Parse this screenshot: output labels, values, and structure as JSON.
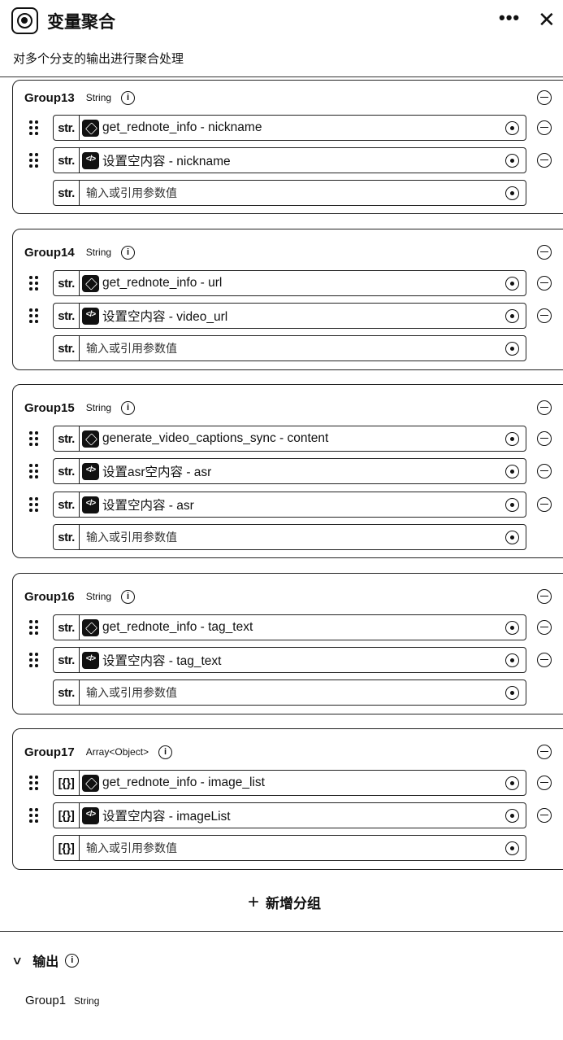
{
  "header": {
    "title": "变量聚合",
    "subtitle": "对多个分支的输出进行聚合处理",
    "icon": "variable-merge-icon"
  },
  "groups": [
    {
      "name": "Group13",
      "type": "String",
      "rows": [
        {
          "type_tag": "str.",
          "icon": "plugin",
          "text": "get_rednote_info - nickname"
        },
        {
          "type_tag": "str.",
          "icon": "code",
          "text": "设置空内容 - nickname"
        }
      ],
      "empty_type_tag": "str.",
      "placeholder": "输入或引用参数值"
    },
    {
      "name": "Group14",
      "type": "String",
      "rows": [
        {
          "type_tag": "str.",
          "icon": "plugin",
          "text": "get_rednote_info - url"
        },
        {
          "type_tag": "str.",
          "icon": "code",
          "text": "设置空内容 - video_url"
        }
      ],
      "empty_type_tag": "str.",
      "placeholder": "输入或引用参数值"
    },
    {
      "name": "Group15",
      "type": "String",
      "rows": [
        {
          "type_tag": "str.",
          "icon": "plugin",
          "text": "generate_video_captions_sync - content"
        },
        {
          "type_tag": "str.",
          "icon": "code",
          "text": "设置asr空内容 - asr"
        },
        {
          "type_tag": "str.",
          "icon": "code",
          "text": "设置空内容 - asr"
        }
      ],
      "empty_type_tag": "str.",
      "placeholder": "输入或引用参数值"
    },
    {
      "name": "Group16",
      "type": "String",
      "rows": [
        {
          "type_tag": "str.",
          "icon": "plugin",
          "text": "get_rednote_info - tag_text"
        },
        {
          "type_tag": "str.",
          "icon": "code",
          "text": "设置空内容 - tag_text"
        }
      ],
      "empty_type_tag": "str.",
      "placeholder": "输入或引用参数值"
    },
    {
      "name": "Group17",
      "type": "Array<Object>",
      "rows": [
        {
          "type_tag": "[{}]",
          "icon": "plugin",
          "text": "get_rednote_info - image_list"
        },
        {
          "type_tag": "[{}]",
          "icon": "code",
          "text": "设置空内容 - imageList"
        }
      ],
      "empty_type_tag": "[{}]",
      "placeholder": "输入或引用参数值"
    }
  ],
  "add_group_label": "新增分组",
  "output": {
    "label": "输出",
    "items": [
      {
        "name": "Group1",
        "type": "String"
      }
    ]
  }
}
